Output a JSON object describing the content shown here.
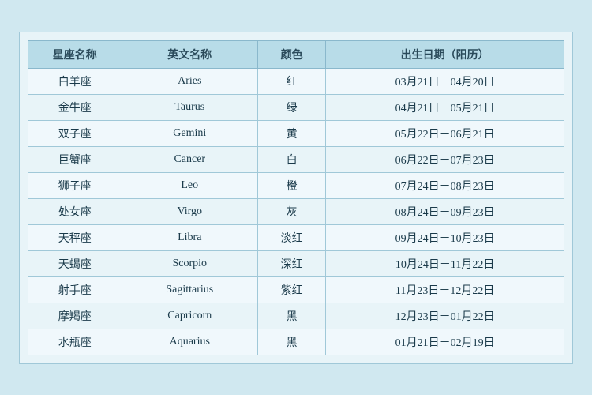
{
  "table": {
    "headers": {
      "col1": "星座名称",
      "col2": "英文名称",
      "col3": "颜色",
      "col4": "出生日期（阳历）"
    },
    "rows": [
      {
        "chinese": "白羊座",
        "english": "Aries",
        "color": "红",
        "date": "03月21日－04月20日"
      },
      {
        "chinese": "金牛座",
        "english": "Taurus",
        "color": "绿",
        "date": "04月21日－05月21日"
      },
      {
        "chinese": "双子座",
        "english": "Gemini",
        "color": "黄",
        "date": "05月22日－06月21日"
      },
      {
        "chinese": "巨蟹座",
        "english": "Cancer",
        "color": "白",
        "date": "06月22日－07月23日"
      },
      {
        "chinese": "狮子座",
        "english": "Leo",
        "color": "橙",
        "date": "07月24日－08月23日"
      },
      {
        "chinese": "处女座",
        "english": "Virgo",
        "color": "灰",
        "date": "08月24日－09月23日"
      },
      {
        "chinese": "天秤座",
        "english": "Libra",
        "color": "淡红",
        "date": "09月24日－10月23日"
      },
      {
        "chinese": "天蝎座",
        "english": "Scorpio",
        "color": "深红",
        "date": "10月24日－11月22日"
      },
      {
        "chinese": "射手座",
        "english": "Sagittarius",
        "color": "紫红",
        "date": "11月23日－12月22日"
      },
      {
        "chinese": "摩羯座",
        "english": "Capricorn",
        "color": "黑",
        "date": "12月23日－01月22日"
      },
      {
        "chinese": "水瓶座",
        "english": "Aquarius",
        "color": "黑",
        "date": "01月21日－02月19日"
      }
    ]
  }
}
